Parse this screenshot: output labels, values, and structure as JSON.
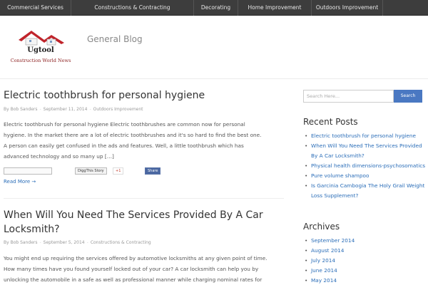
{
  "nav": {
    "items": [
      {
        "label": "Commercial Services"
      },
      {
        "label": "Constructions & Contracting"
      },
      {
        "label": "Decorating"
      },
      {
        "label": "Home Improvement"
      },
      {
        "label": "Outdoors Improvement"
      }
    ]
  },
  "header": {
    "logo_brand": "Ugtool",
    "logo_tagline": "Construction World News",
    "site_title": "General Blog"
  },
  "posts": [
    {
      "title": "Electric toothbrush for personal hygiene",
      "meta": {
        "by": "By",
        "author": "Bob Sanders",
        "date": "September 11, 2014",
        "category": "Outdoors Improvement"
      },
      "excerpt_lines": [
        "Electric toothbrush for personal hygiene Electric toothbrushes are common now for personal",
        "hygiene. In the market there are a lot of electric toothbrushes and it's so hard to find the best one.",
        "A person can easily get confused in the ads and features. Well, a little toothbrush which has",
        "advanced technology and so many up […]"
      ],
      "share": {
        "digg_label": "DiggThis Story",
        "gplus_label": "+1",
        "fb_label": "Share"
      },
      "read_more": "Read More →"
    },
    {
      "title_lines": [
        "When Will You Need The Services Provided By A Car",
        "Locksmith?"
      ],
      "meta": {
        "by": "By",
        "author": "Bob Sanders",
        "date": "September 5, 2014",
        "category": "Constructions & Contracting"
      },
      "excerpt_lines": [
        "You might end up requiring the services offered by automotive locksmiths at any given point of time.",
        "How many times have you found yourself locked out of your car? A car locksmith can help you by",
        "unlocking the automobile in a safe as well as professional manner while charging nominal rates for"
      ]
    }
  ],
  "sidebar": {
    "search": {
      "placeholder": "Search Here...",
      "button": "Search"
    },
    "recent_posts": {
      "title": "Recent Posts",
      "items": [
        "Electric toothbrush for personal hygiene",
        "When Will You Need The Services Provided By A Car Locksmith?",
        "Physical health dimensions-psychosomatics",
        "Pure volume shampoo",
        "Is Garcinia Cambogia The Holy Grail Weight Loss Supplement?"
      ]
    },
    "archives": {
      "title": "Archives",
      "items": [
        "September 2014",
        "August 2014",
        "July 2014",
        "June 2014",
        "May 2014"
      ]
    }
  },
  "colors": {
    "nav_bg": "#3d3d3d",
    "link": "#2a6db8",
    "search_button": "#4a78c2",
    "logo_roof": "#c0242b"
  }
}
